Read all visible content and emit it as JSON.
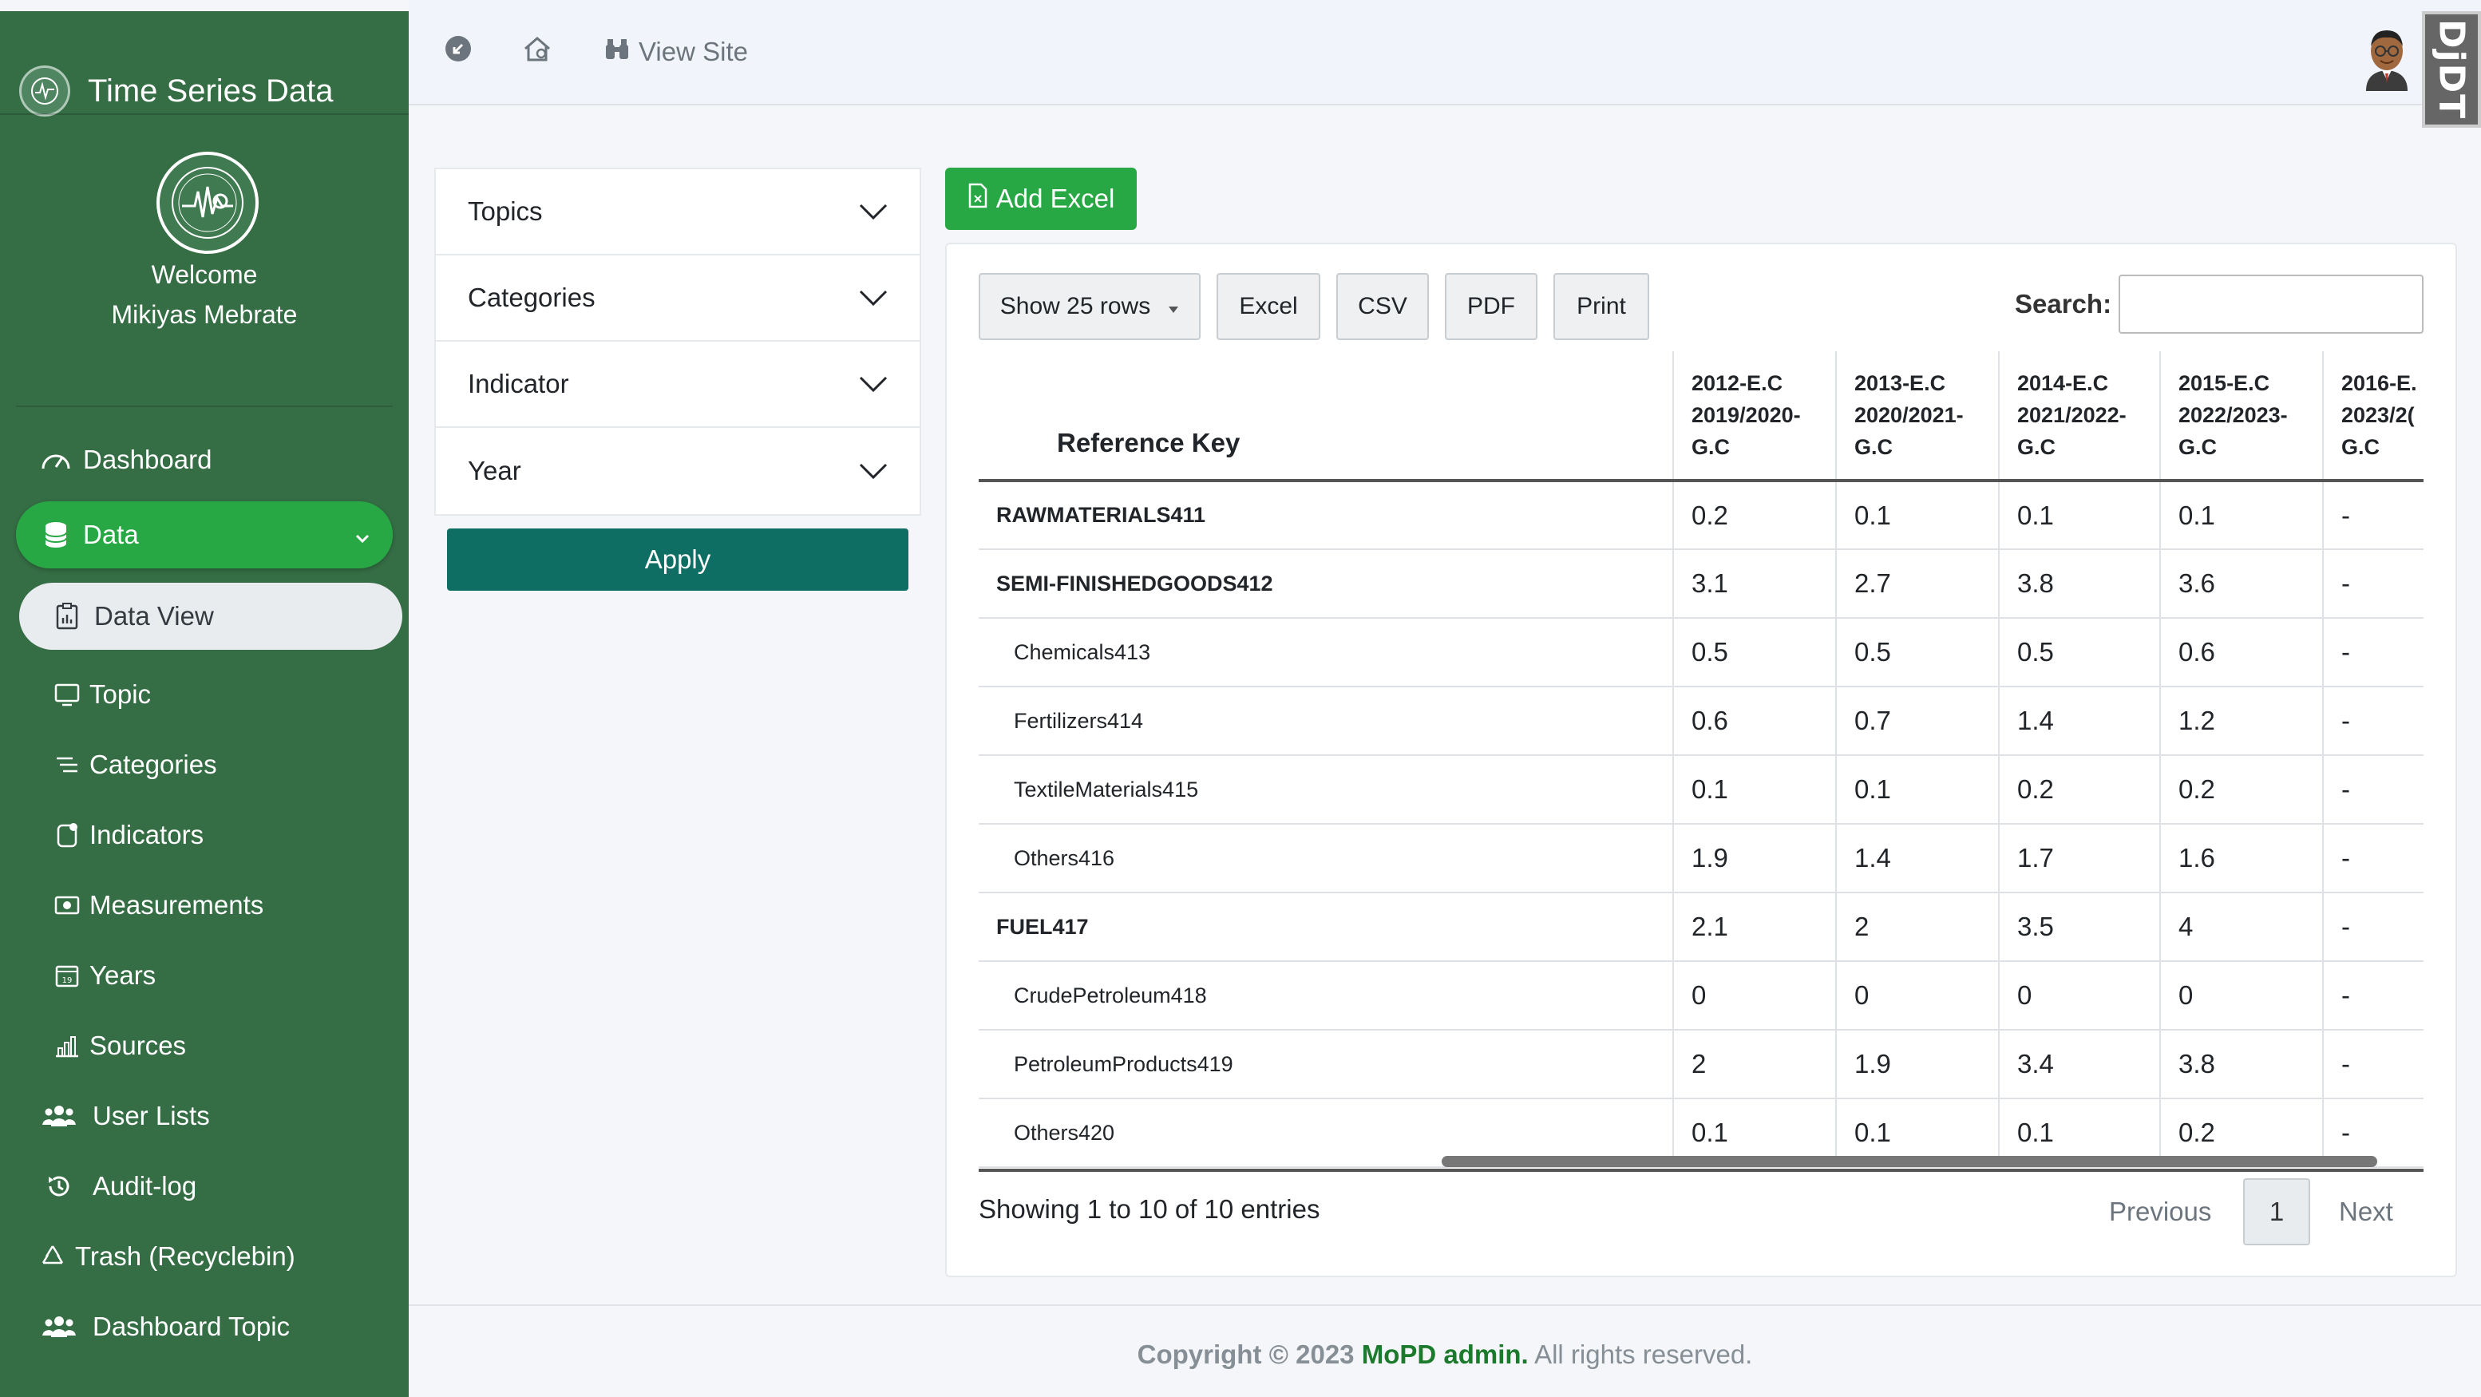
{
  "sidebar": {
    "brand": "Time Series Data",
    "welcome_line1": "Welcome",
    "welcome_line2": "Mikiyas Mebrate",
    "items": [
      {
        "label": "Dashboard",
        "icon": "gauge-icon"
      },
      {
        "label": "Data",
        "icon": "database-icon"
      },
      {
        "label": "Data View",
        "icon": "report-icon"
      },
      {
        "label": "Topic",
        "icon": "monitor-icon"
      },
      {
        "label": "Categories",
        "icon": "list-icon"
      },
      {
        "label": "Indicators",
        "icon": "indicator-icon"
      },
      {
        "label": "Measurements",
        "icon": "money-icon"
      },
      {
        "label": "Years",
        "icon": "calendar-icon"
      },
      {
        "label": "Sources",
        "icon": "chart-icon"
      },
      {
        "label": "User Lists",
        "icon": "users-icon"
      },
      {
        "label": "Audit-log",
        "icon": "history-icon"
      },
      {
        "label": "Trash (Recyclebin)",
        "icon": "recycle-icon"
      },
      {
        "label": "Dashboard Topic",
        "icon": "users-icon"
      }
    ]
  },
  "topbar": {
    "view_site": "View Site",
    "debug_toolbar": "DjDT"
  },
  "filters": {
    "items": [
      "Topics",
      "Categories",
      "Indicator",
      "Year"
    ],
    "apply": "Apply"
  },
  "add_excel": "Add Excel",
  "table_controls": {
    "show_rows": "Show 25 rows",
    "excel": "Excel",
    "csv": "CSV",
    "pdf": "PDF",
    "print": "Print",
    "search_label": "Search:",
    "search_value": ""
  },
  "table": {
    "key_header": "Reference Key",
    "columns": [
      [
        "2012-E.C",
        "2019/2020-",
        "G.C"
      ],
      [
        "2013-E.C",
        "2020/2021-",
        "G.C"
      ],
      [
        "2014-E.C",
        "2021/2022-",
        "G.C"
      ],
      [
        "2015-E.C",
        "2022/2023-",
        "G.C"
      ],
      [
        "2016-E.",
        "2023/2(",
        "G.C"
      ]
    ],
    "rows": [
      {
        "key": "RAWMATERIALS411",
        "values": [
          "0.2",
          "0.1",
          "0.1",
          "0.1",
          "-"
        ]
      },
      {
        "key": "SEMI-FINISHEDGOODS412",
        "values": [
          "3.1",
          "2.7",
          "3.8",
          "3.6",
          "-"
        ]
      },
      {
        "key": "Chemicals413",
        "values": [
          "0.5",
          "0.5",
          "0.5",
          "0.6",
          "-"
        ]
      },
      {
        "key": "Fertilizers414",
        "values": [
          "0.6",
          "0.7",
          "1.4",
          "1.2",
          "-"
        ]
      },
      {
        "key": "TextileMaterials415",
        "values": [
          "0.1",
          "0.1",
          "0.2",
          "0.2",
          "-"
        ]
      },
      {
        "key": "Others416",
        "values": [
          "1.9",
          "1.4",
          "1.7",
          "1.6",
          "-"
        ]
      },
      {
        "key": "FUEL417",
        "values": [
          "2.1",
          "2",
          "3.5",
          "4",
          "-"
        ]
      },
      {
        "key": "CrudePetroleum418",
        "values": [
          "0",
          "0",
          "0",
          "0",
          "-"
        ]
      },
      {
        "key": "PetroleumProducts419",
        "values": [
          "2",
          "1.9",
          "3.4",
          "3.8",
          "-"
        ]
      },
      {
        "key": "Others420",
        "values": [
          "0.1",
          "0.1",
          "0.1",
          "0.2",
          "-"
        ]
      }
    ],
    "info": "Showing 1 to 10 of 10 entries"
  },
  "pagination": {
    "previous": "Previous",
    "page": "1",
    "next": "Next"
  },
  "footer": {
    "copyright": "Copyright © 2023",
    "brand": "MoPD admin.",
    "rights": "All rights reserved."
  }
}
